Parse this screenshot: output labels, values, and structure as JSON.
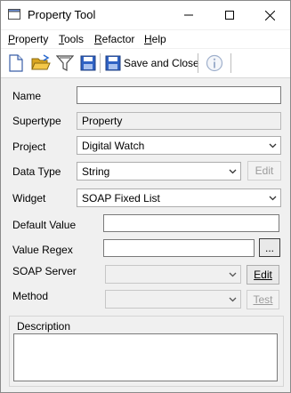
{
  "window": {
    "title": "Property Tool"
  },
  "menu": [
    {
      "key": "P",
      "rest": "roperty"
    },
    {
      "key": "T",
      "rest": "ools"
    },
    {
      "key": "R",
      "rest": "efactor"
    },
    {
      "key": "H",
      "rest": "elp"
    }
  ],
  "toolbar": {
    "save_and_close_label": "Save and Close",
    "icons": [
      "new-document-icon",
      "open-folder-icon",
      "filter-icon",
      "save-icon",
      "save-and-close-icon",
      "info-icon"
    ]
  },
  "form": {
    "name": {
      "label": "Name",
      "value": ""
    },
    "supertype": {
      "label": "Supertype",
      "value": "Property"
    },
    "project": {
      "label": "Project",
      "value": "Digital Watch"
    },
    "data_type": {
      "label": "Data Type",
      "value": "String",
      "edit_label": "Edit"
    },
    "widget": {
      "label": "Widget",
      "value": "SOAP Fixed List"
    },
    "default_value": {
      "label": "Default Value",
      "value": ""
    },
    "value_regex": {
      "label": "Value Regex",
      "value": "",
      "browse_label": "..."
    },
    "soap_server": {
      "label": "SOAP Server",
      "value": "",
      "edit_label": "Edit"
    },
    "method": {
      "label": "Method",
      "value": "",
      "test_label": "Test"
    },
    "description": {
      "label": "Description",
      "value": ""
    }
  }
}
